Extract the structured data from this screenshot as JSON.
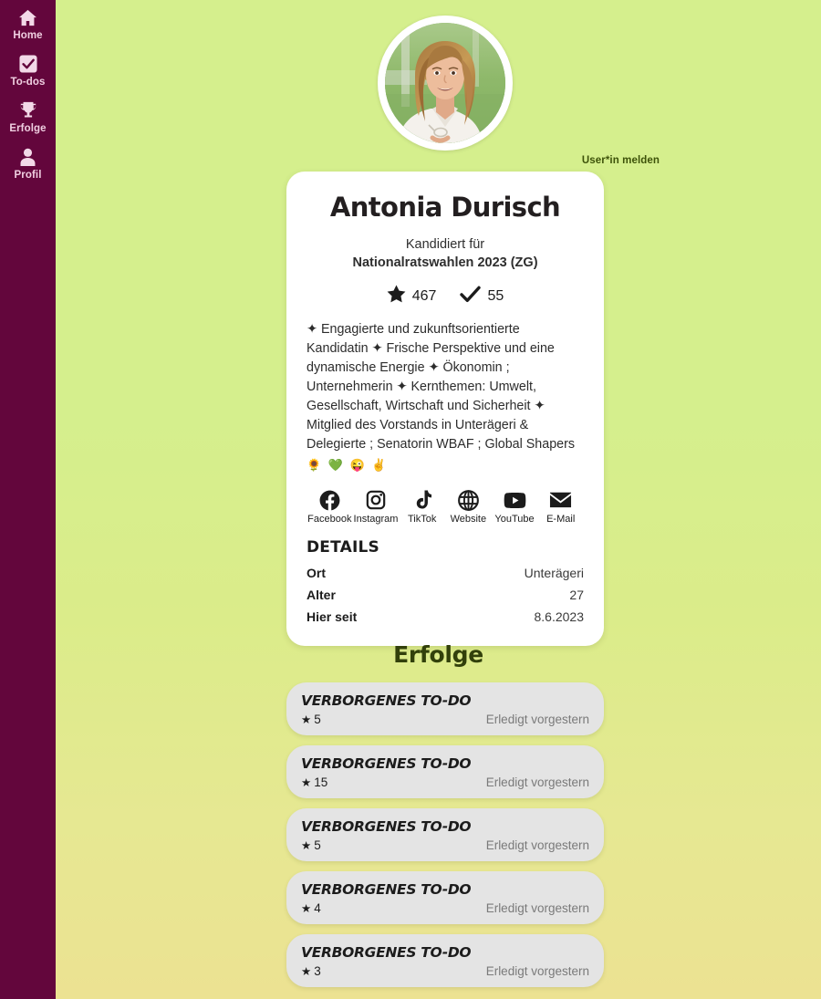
{
  "sidebar": {
    "items": [
      {
        "label": "Home",
        "icon": "home-icon"
      },
      {
        "label": "To-dos",
        "icon": "checkbox-icon"
      },
      {
        "label": "Erfolge",
        "icon": "trophy-icon"
      },
      {
        "label": "Profil",
        "icon": "person-icon"
      }
    ]
  },
  "report": {
    "label": "User*in melden"
  },
  "profile": {
    "name": "Antonia Durisch",
    "candidacy_prefix": "Kandidiert für",
    "candidacy_election": "Nationalratswahlen 2023 (ZG)",
    "stats": {
      "stars_icon": "star-icon",
      "stars": "467",
      "checks_icon": "check-icon",
      "checks": "55"
    },
    "bio": "✦ Engagierte und zukunftsorientierte Kandidatin ✦ Frische Perspektive und eine dynamische Energie ✦ Ökonomin ; Unternehmerin ✦ Kernthemen: Umwelt, Gesellschaft, Wirtschaft und Sicherheit ✦ Mitglied des Vorstands in Unterägeri & Delegierte ; Senatorin WBAF ; Global Shapers",
    "bio_emoji": "🌻 💚 😜 ✌",
    "socials": [
      {
        "label": "Facebook",
        "icon": "facebook-icon"
      },
      {
        "label": "Instagram",
        "icon": "instagram-icon"
      },
      {
        "label": "TikTok",
        "icon": "tiktok-icon"
      },
      {
        "label": "Website",
        "icon": "globe-icon"
      },
      {
        "label": "YouTube",
        "icon": "youtube-icon"
      },
      {
        "label": "E-Mail",
        "icon": "envelope-icon"
      }
    ],
    "details_title": "DETAILS",
    "details": [
      {
        "key": "Ort",
        "value": "Unterägeri"
      },
      {
        "key": "Alter",
        "value": "27"
      },
      {
        "key": "Hier seit",
        "value": "8.6.2023"
      }
    ]
  },
  "achievements": {
    "title": "Erfolge",
    "items": [
      {
        "name": "VERBORGENES TO-DO",
        "points": "5",
        "date": "Erledigt vorgestern"
      },
      {
        "name": "VERBORGENES TO-DO",
        "points": "15",
        "date": "Erledigt vorgestern"
      },
      {
        "name": "VERBORGENES TO-DO",
        "points": "5",
        "date": "Erledigt vorgestern"
      },
      {
        "name": "VERBORGENES TO-DO",
        "points": "4",
        "date": "Erledigt vorgestern"
      },
      {
        "name": "VERBORGENES TO-DO",
        "points": "3",
        "date": "Erledigt vorgestern"
      }
    ]
  },
  "colors": {
    "sidebar_bg": "#63063c",
    "page_bg_top": "#d5ef8d",
    "page_bg_bottom": "#ece292",
    "card_bg": "#ffffff",
    "achievement_bg": "#e4e4e4",
    "accent_dark_green": "#32400b"
  }
}
